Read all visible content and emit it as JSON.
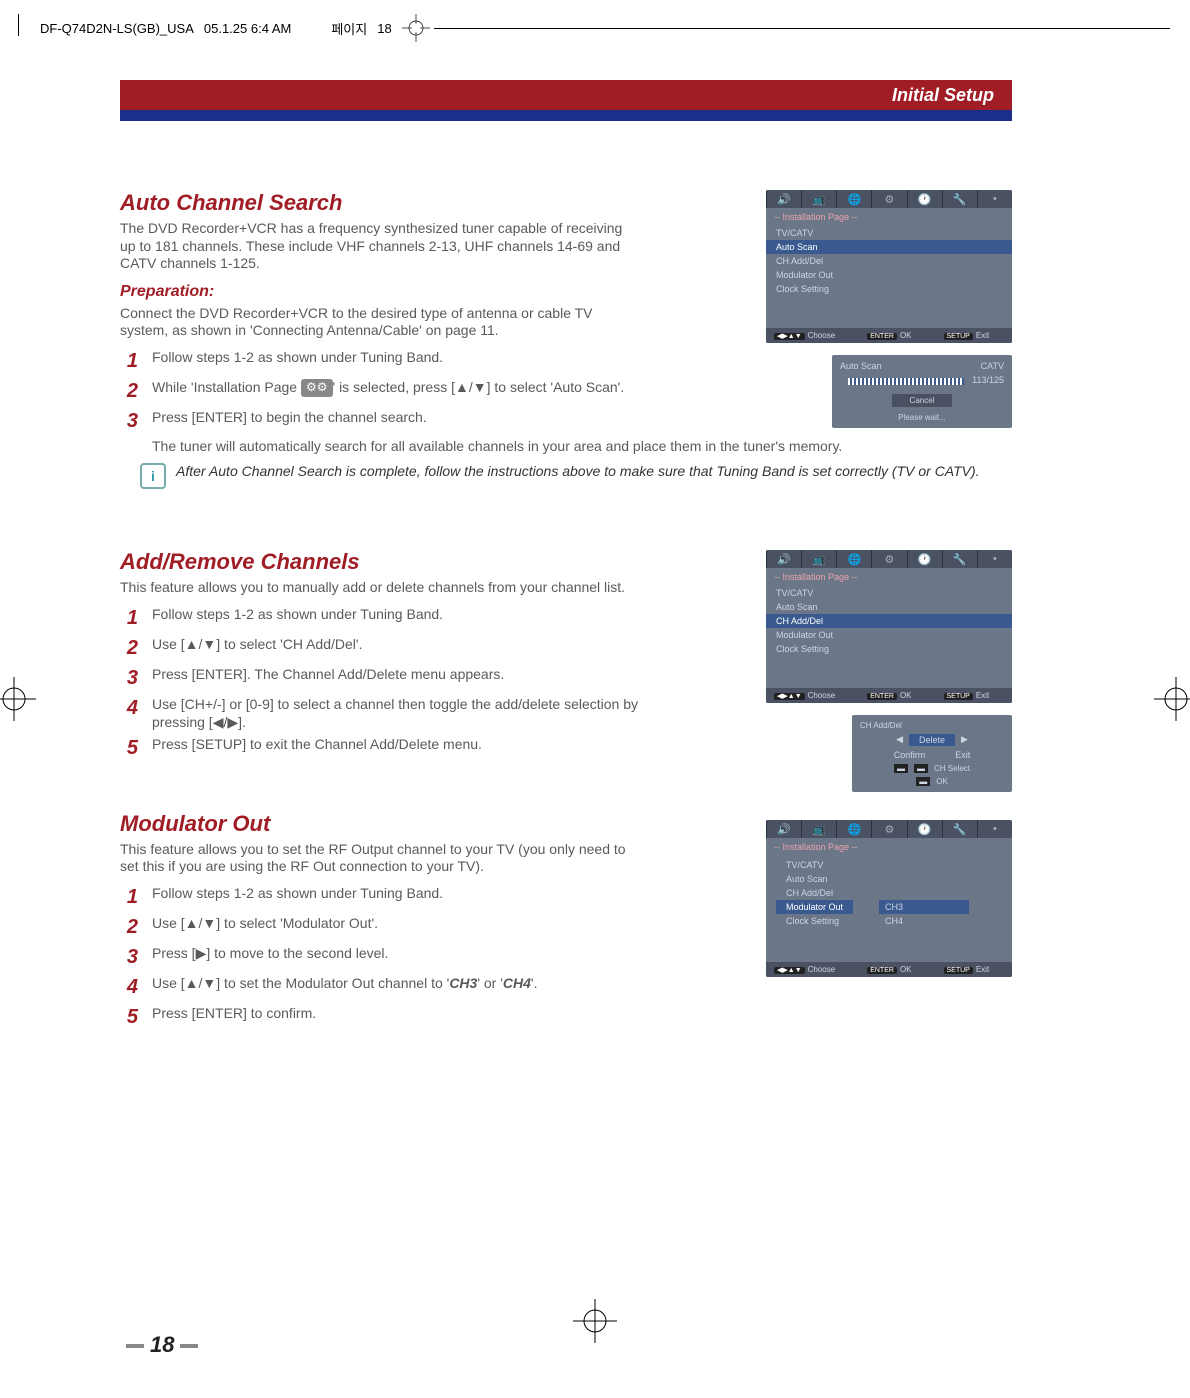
{
  "header": {
    "file": "DF-Q74D2N-LS(GB)_USA",
    "date": "05.1.25 6:4 AM",
    "page_small": "18"
  },
  "topbar": {
    "title": "Initial Setup"
  },
  "sec1": {
    "h": "Auto Channel Search",
    "p1": "The DVD Recorder+VCR has a frequency synthesized tuner capable of receiving up to 181 channels. These include VHF channels 2-13, UHF channels 14-69 and CATV channels 1-125.",
    "prep_h": "Preparation:",
    "prep": "Connect the DVD Recorder+VCR to the desired type of antenna or cable TV system, as shown in 'Connecting Antenna/Cable' on page 11.",
    "s1": "Follow steps 1-2 as shown under Tuning Band.",
    "s2a": "While 'Installation Page ",
    "s2b": "' is selected, press [▲/▼] to select 'Auto Scan'.",
    "s3": "Press [ENTER] to begin the channel search.",
    "s3b": "The tuner will automatically search for all available channels in your area and place them in the tuner's memory.",
    "note": "After Auto Channel Search is complete, follow the instructions above to make sure that Tuning Band is set correctly (TV or CATV)."
  },
  "sec2": {
    "h": "Add/Remove Channels",
    "p1": "This feature allows you to manually add or delete channels from your channel list.",
    "s1": "Follow steps 1-2 as shown under Tuning Band.",
    "s2": "Use [▲/▼] to select 'CH Add/Del'.",
    "s3": "Press [ENTER]. The Channel Add/Delete menu appears.",
    "s4": "Use [CH+/-] or [0-9] to select a channel then toggle the add/delete selection by pressing [◀/▶].",
    "s5": "Press [SETUP] to exit the Channel Add/Delete menu."
  },
  "sec3": {
    "h": "Modulator Out",
    "p1": "This feature allows you to set the RF Output channel to your TV (you only need to set this if you are using the RF Out connection to your TV).",
    "s1": "Follow steps 1-2 as shown under Tuning Band.",
    "s2": "Use [▲/▼] to select 'Modulator Out'.",
    "s3": "Press [▶] to move to the second level.",
    "s4a": "Use [▲/▼] to set the Modulator Out channel to '",
    "s4b": "CH3",
    "s4c": "' or '",
    "s4d": "CH4",
    "s4e": "'.",
    "s5": "Press [ENTER] to confirm."
  },
  "fig": {
    "title": "-- Installation Page --",
    "items": [
      "TV/CATV",
      "Auto Scan",
      "CH Add/Del",
      "Modulator Out",
      "Clock Setting"
    ],
    "foot_choose": "Choose",
    "foot_ok": "OK",
    "foot_exit": "Exit",
    "foot_k1": "◀▶▲▼",
    "foot_k2": "ENTER",
    "foot_k3": "SETUP",
    "scan": {
      "l": "Auto Scan",
      "r": "CATV",
      "count": "113/125",
      "cancel": "Cancel",
      "wait": "Please wait..."
    },
    "adddel": {
      "t": "CH Add/Del",
      "del": "Delete",
      "conf": "Confirm",
      "exit": "Exit",
      "chsel": "CH Select",
      "ok": "OK"
    },
    "mod": {
      "ch3": "CH3",
      "ch4": "CH4"
    }
  },
  "page": "18"
}
